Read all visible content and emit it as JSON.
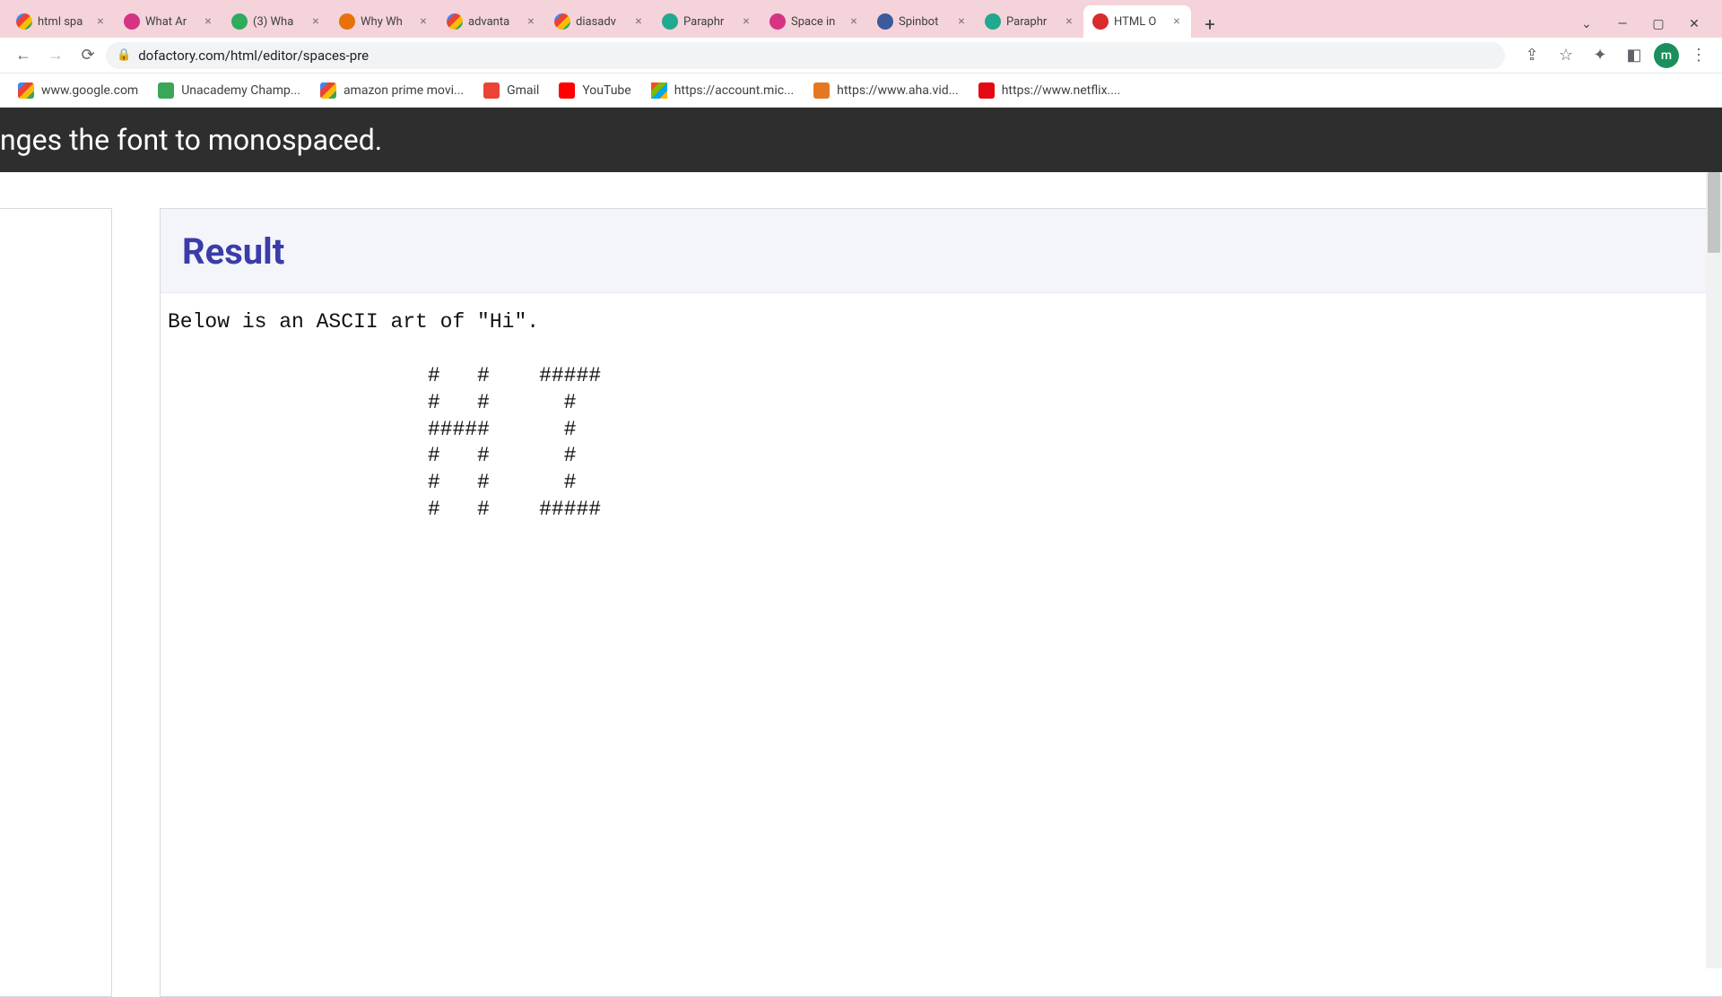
{
  "tabs": [
    {
      "title": "html spa",
      "favicon_class": "g-multi"
    },
    {
      "title": "What Ar",
      "favicon_class": "pink-sq"
    },
    {
      "title": "(3) Wha",
      "favicon_class": "green-c"
    },
    {
      "title": "Why Wh",
      "favicon_class": "orange-c"
    },
    {
      "title": "advanta",
      "favicon_class": "g-multi"
    },
    {
      "title": "diasadv",
      "favicon_class": "g-multi"
    },
    {
      "title": "Paraphr",
      "favicon_class": "teal-sq"
    },
    {
      "title": "Space in",
      "favicon_class": "pink-sq"
    },
    {
      "title": "Spinbot",
      "favicon_class": "sb"
    },
    {
      "title": "Paraphr",
      "favicon_class": "teal-sq"
    },
    {
      "title": "HTML O",
      "favicon_class": "df",
      "active": true
    }
  ],
  "omnibox": {
    "url": "dofactory.com/html/editor/spaces-pre"
  },
  "avatar_letter": "m",
  "bookmarks": [
    {
      "label": "www.google.com",
      "icon_class": "g-multi"
    },
    {
      "label": "Unacademy Champ...",
      "icon_class": "ua"
    },
    {
      "label": "amazon prime movi...",
      "icon_class": "g-multi"
    },
    {
      "label": "Gmail",
      "icon_class": "gm"
    },
    {
      "label": "YouTube",
      "icon_class": "yt"
    },
    {
      "label": "https://account.mic...",
      "icon_class": "ms"
    },
    {
      "label": "https://www.aha.vid...",
      "icon_class": "aha"
    },
    {
      "label": "https://www.netflix....",
      "icon_class": "nf"
    }
  ],
  "banner_text": "nges the font to monospaced.",
  "result": {
    "title": "Result",
    "pre_text": "Below is an ASCII art of \"Hi\".\n\n                     #   #    #####\n                     #   #      #\n                     #####      #\n                     #   #      #\n                     #   #      #\n                     #   #    #####"
  }
}
